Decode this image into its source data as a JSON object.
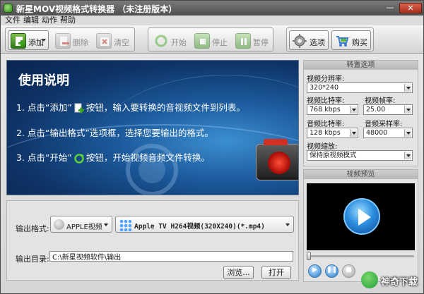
{
  "window": {
    "title": "新星MOV视频格式转换器 （未注册版本）",
    "min_glyph": "—",
    "close_glyph": "✕"
  },
  "menu": [
    "文件",
    "编辑",
    "动作",
    "帮助"
  ],
  "toolbar": {
    "add": "添加",
    "delete": "删除",
    "clear": "清空",
    "start": "开始",
    "stop": "停止",
    "pause": "暂停",
    "options": "选项",
    "buy": "购买"
  },
  "banner": {
    "heading": "使用说明",
    "step1_pre": "1. 点击“添加”",
    "step1_post": "按钮，输入要转换的音视频文件到列表。",
    "step2": "2. 点击“输出格式”选项框，选择您要输出的格式。",
    "step3_pre": "3. 点击“开始”",
    "step3_post": "按钮，开始视频音频文件转换。"
  },
  "output": {
    "format_label": "输出格式:",
    "format_category": "APPLE视频",
    "format_value": "Apple TV H264视频(320X240)(*.mp4)",
    "dir_label": "输出目录:",
    "dir_value": "C:\\新星视频软件\\输出",
    "browse": "浏览...",
    "open": "打开"
  },
  "settings": {
    "header": "转置选项",
    "resolution_label": "视频分辨率:",
    "resolution_value": "320*240",
    "vbitrate_label": "视频比特率:",
    "vbitrate_value": "768 kbps",
    "framerate_label": "视频帧率:",
    "framerate_value": "25.00",
    "abitrate_label": "音频比特率:",
    "abitrate_value": "128 kbps",
    "samplerate_label": "音频采样率:",
    "samplerate_value": "48000",
    "scale_label": "视频缩放:",
    "scale_value": "保持原视频模式"
  },
  "preview": {
    "header": "视频预览"
  },
  "watermark": {
    "text": "神奇下载"
  }
}
